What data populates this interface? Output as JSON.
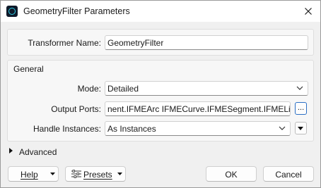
{
  "window": {
    "title": "GeometryFilter Parameters"
  },
  "transformer": {
    "label": "Transformer Name:",
    "value": "GeometryFilter"
  },
  "general": {
    "heading": "General",
    "mode": {
      "label": "Mode:",
      "value": "Detailed"
    },
    "output_ports": {
      "label": "Output Ports:",
      "value": "nent.IFMEArc IFMECurve.IFMESegment.IFMELine",
      "browse_label": "..."
    },
    "handle_instances": {
      "label": "Handle Instances:",
      "value": "As Instances"
    }
  },
  "advanced": {
    "label": "Advanced"
  },
  "footer": {
    "help": "Help",
    "presets": "Presets",
    "ok": "OK",
    "cancel": "Cancel"
  }
}
